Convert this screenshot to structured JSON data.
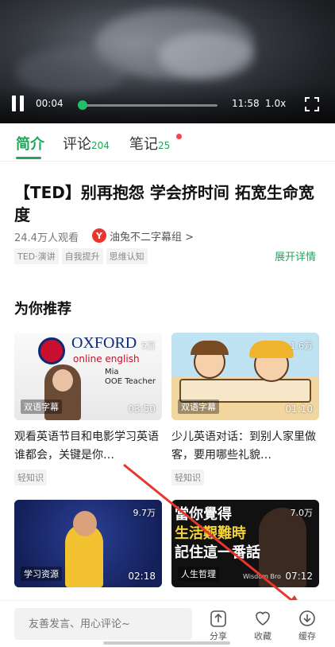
{
  "player": {
    "current_time": "00:04",
    "duration": "11:58",
    "speed": "1.0x",
    "progress": 0.01
  },
  "tabs": [
    {
      "label": "简介",
      "count": ""
    },
    {
      "label": "评论",
      "count": "204"
    },
    {
      "label": "笔记",
      "count": "25"
    }
  ],
  "video": {
    "title": "【TED】别再抱怨 学会挤时间 拓宽生命宽度",
    "views": "24.4万人观看",
    "uploader": "油兔不二字幕组 >",
    "tags": [
      "TED·演讲",
      "自我提升",
      "思维认知"
    ],
    "expand_label": "展开详情"
  },
  "recommend": {
    "section_title": "为你推荐",
    "cards": [
      {
        "views": "5万",
        "badge": "双语字幕",
        "duration": "03:50",
        "title": "观看英语节目和电影学习英语谁都会，关键是你…",
        "tag": "轻知识",
        "thumb_text": [
          "OXFORD",
          "online english",
          "Mia",
          "OOE Teacher"
        ]
      },
      {
        "views": "1.6万",
        "badge": "双语字幕",
        "duration": "01:10",
        "title": "少儿英语对话：到别人家里做客，要用哪些礼貌…",
        "tag": "轻知识",
        "thumb_text": []
      },
      {
        "views": "9.7万",
        "badge": "学习资源",
        "duration": "02:18",
        "title": "",
        "tag": "",
        "thumb_text": []
      },
      {
        "views": "7.0万",
        "badge": "人生哲理",
        "duration": "07:12",
        "title": "",
        "tag": "",
        "thumb_text": [
          "當你覺得",
          "生活艱難時",
          "記住這一番話",
          "Wisdom Bro"
        ]
      }
    ]
  },
  "bottom_bar": {
    "comment_placeholder": "友善发言、用心评论~",
    "share_label": "分享",
    "favorite_label": "收藏",
    "cache_label": "缓存"
  },
  "colors": {
    "accent": "#1fa65b",
    "notification": "#f4414d",
    "annotation_arrow": "#e8362f"
  }
}
